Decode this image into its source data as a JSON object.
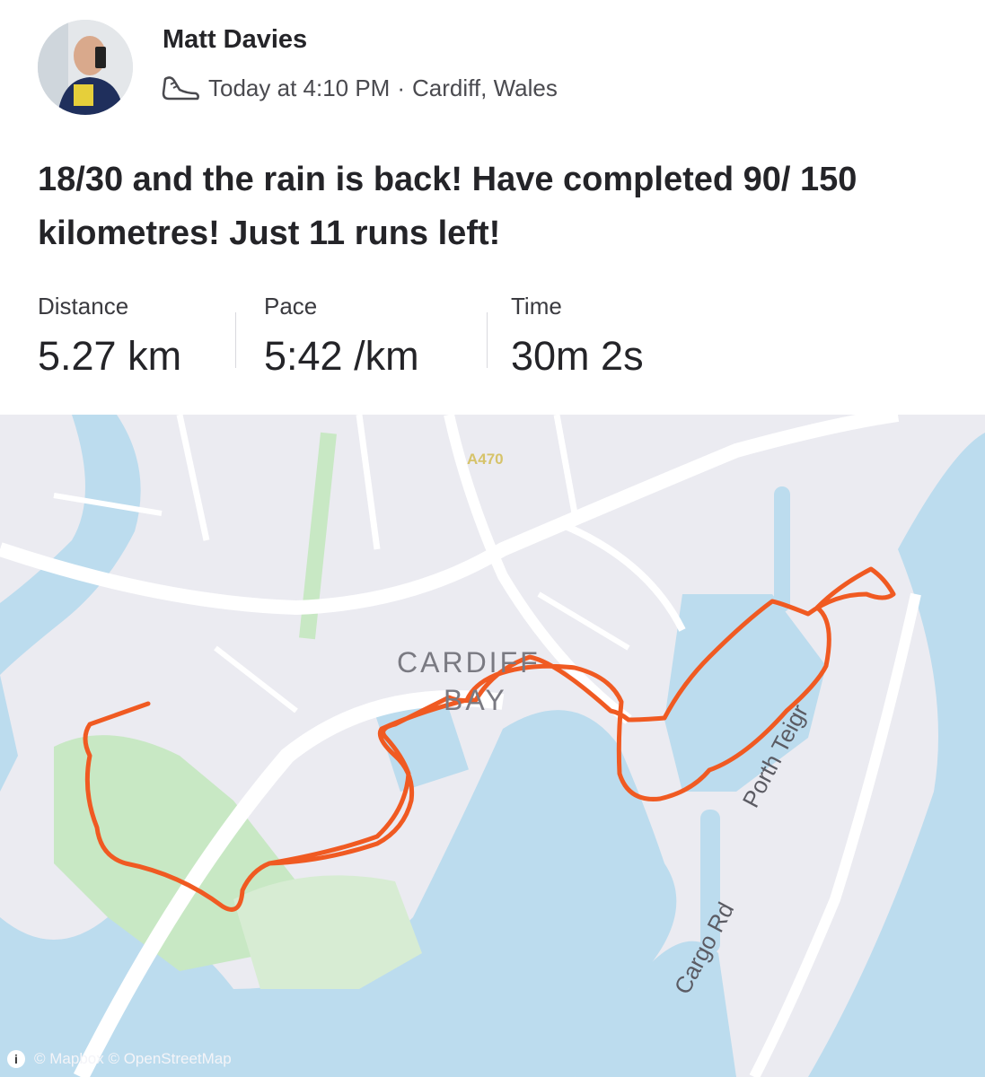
{
  "activity": {
    "athlete_name": "Matt Davies",
    "timestamp": "Today at 4:10 PM",
    "separator": "·",
    "location": "Cardiff, Wales",
    "title": "18/30 and the rain is back! Have completed 90/ 150 kilometres! Just 11 runs left!"
  },
  "stats": {
    "distance": {
      "label": "Distance",
      "value": "5.27 km"
    },
    "pace": {
      "label": "Pace",
      "value": "5:42 /km"
    },
    "time": {
      "label": "Time",
      "value": "30m 2s"
    }
  },
  "map": {
    "place_label_1": "CARDIFF",
    "place_label_2": "BAY",
    "road_label_1": "Porth Teigr",
    "road_label_2": "Cargo Rd",
    "road_label_3": "A470",
    "attribution": "© Mapbox © OpenStreetMap",
    "info_icon": "i",
    "colors": {
      "route": "#f05a22",
      "water": "#bcdcee",
      "park": "#c8e8c4",
      "land": "#ebebf1",
      "road": "#ffffff"
    }
  },
  "icons": {
    "shoe": "running-shoe-icon",
    "info": "info-icon"
  }
}
